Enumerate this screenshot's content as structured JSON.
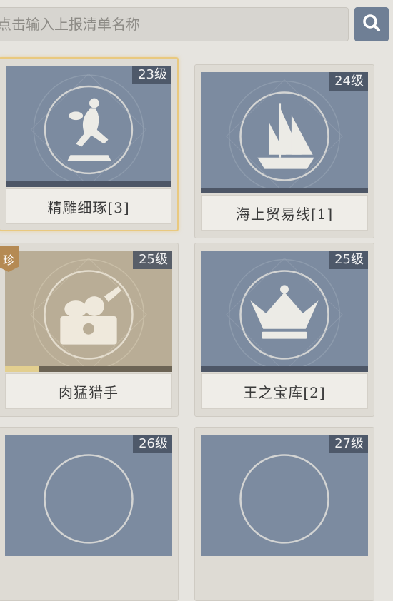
{
  "search": {
    "placeholder": "点击输入上报清单名称"
  },
  "icons": {
    "search": "search-icon",
    "rare": "rare-tag"
  },
  "colors": {
    "accent": "#6f7f95",
    "selected_border": "#e9c97f",
    "progress_fill": "#e3cf8f"
  },
  "rare_label": "珍",
  "cards": [
    {
      "name": "精雕细琢[3]",
      "level": "23级",
      "icon": "discobolus-statue-icon",
      "progress": 0
    },
    {
      "name": "海上贸易线[1]",
      "level": "24级",
      "icon": "sailing-ship-icon",
      "progress": 0
    },
    {
      "name": "肉猛猎手",
      "level": "25级",
      "icon": "treasure-chest-icon",
      "progress": 0.2
    },
    {
      "name": "王之宝库[2]",
      "level": "25级",
      "icon": "crown-icon",
      "progress": 0
    },
    {
      "name": "",
      "level": "26级",
      "icon": "",
      "progress": 0
    },
    {
      "name": "",
      "level": "27级",
      "icon": "",
      "progress": 0
    }
  ]
}
